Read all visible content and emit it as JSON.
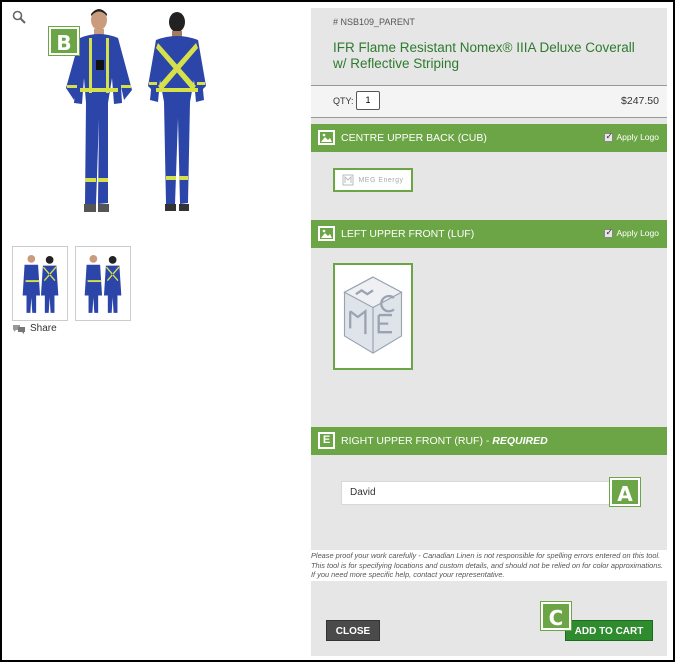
{
  "product": {
    "sku": "# NSB109_PARENT",
    "title_line1": "IFR Flame Resistant Nomex® IIIA Deluxe Coverall",
    "title_line2": "w/ Reflective Striping",
    "qty_label": "QTY:",
    "qty_value": "1",
    "price": "$247.50"
  },
  "share_label": "Share",
  "sections": {
    "cub": {
      "label": "CENTRE UPPER BACK (CUB)",
      "apply_label": "Apply Logo",
      "logo_text": "MEG Energy"
    },
    "luf": {
      "label": "LEFT UPPER FRONT (LUF)",
      "apply_label": "Apply Logo"
    },
    "ruf": {
      "label": "RIGHT UPPER FRONT (RUF) - ",
      "required": "REQUIRED",
      "input_value": "David"
    }
  },
  "disclaimer": "Please proof your work carefully - Canadian Linen is not responsible for spelling errors entered on this tool. This tool is for specifying locations and custom details, and should not be relied on for color approximations. If you need more specific help, contact your representative.",
  "buttons": {
    "close": "CLOSE",
    "add_to_cart": "ADD TO CART"
  },
  "callouts": {
    "a": "A",
    "b": "B",
    "c": "C"
  },
  "colors": {
    "accent_green": "#6ca545",
    "title_green": "#2e7a2e",
    "cart_green": "#2e8b2e",
    "coverall_blue": "#2b45a8",
    "reflective_yellow": "#d6e04a"
  }
}
